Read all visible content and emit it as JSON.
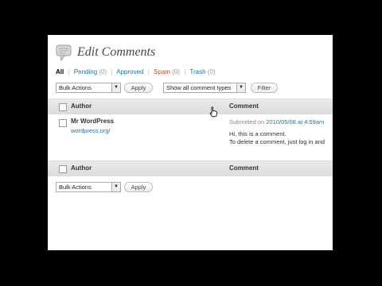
{
  "page": {
    "title": "Edit Comments"
  },
  "filters": [
    {
      "label": "All",
      "count": "",
      "current": true
    },
    {
      "label": "Pending",
      "count": "(0)"
    },
    {
      "label": "Approved",
      "count": ""
    },
    {
      "label": "Spam",
      "count": "(0)",
      "hover": true
    },
    {
      "label": "Trash",
      "count": "(0)"
    }
  ],
  "tablenav_top": {
    "bulk_actions": "Bulk Actions",
    "apply": "Apply",
    "type_filter": "Show all comment types",
    "filter": "Filter"
  },
  "table": {
    "columns": {
      "author": "Author",
      "comment": "Comment"
    },
    "rows": [
      {
        "author_name": "Mr WordPress",
        "author_url": "wordpress.org/",
        "submitted_prefix": "Submitted on",
        "submitted_date": "2010/05/08 at 4:59am",
        "text_line1": "Hi, this is a comment.",
        "text_line2": "To delete a comment, just log in and"
      }
    ]
  },
  "tablenav_bottom": {
    "bulk_actions": "Bulk Actions",
    "apply": "Apply"
  },
  "colors": {
    "link": "#21759b",
    "hover": "#d54e21",
    "header_bg": "#e4e4e4"
  },
  "icons": {
    "page_icon": "comments-bubble-icon",
    "cursor": "hand-pointer-icon"
  }
}
